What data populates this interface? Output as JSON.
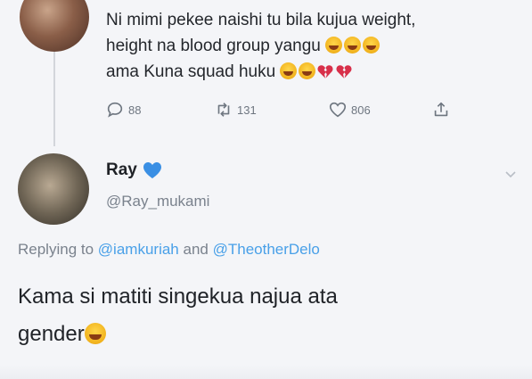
{
  "parent_tweet": {
    "line1": "Ni mimi pekee naishi tu bila kujua weight,",
    "line2": "height na blood group yangu",
    "line3": "ama Kuna squad huku",
    "line2_emojis": [
      "joy-emoji",
      "joy-emoji",
      "joy-emoji"
    ],
    "line3_emojis": [
      "joy-emoji",
      "joy-emoji",
      "broken-heart-emoji",
      "broken-heart-emoji"
    ],
    "replies": "88",
    "retweets": "131",
    "likes": "806"
  },
  "reply_tweet": {
    "name": "Ray",
    "verified_badge": "blue-heart",
    "handle": "@Ray_mukami",
    "replying_prefix": "Replying to",
    "mention1": "@iamkuriah",
    "and_word": "and",
    "mention2": "@TheotherDelo",
    "text_line1": "Kama si matiti singekua najua ata",
    "text_line2": "gender"
  },
  "colors": {
    "background": "#f4f5f8",
    "mention": "#49a0e8",
    "secondary_text": "#7a828d",
    "heart_blue": "#3a8fe4",
    "broken_heart": "#d8304a"
  }
}
